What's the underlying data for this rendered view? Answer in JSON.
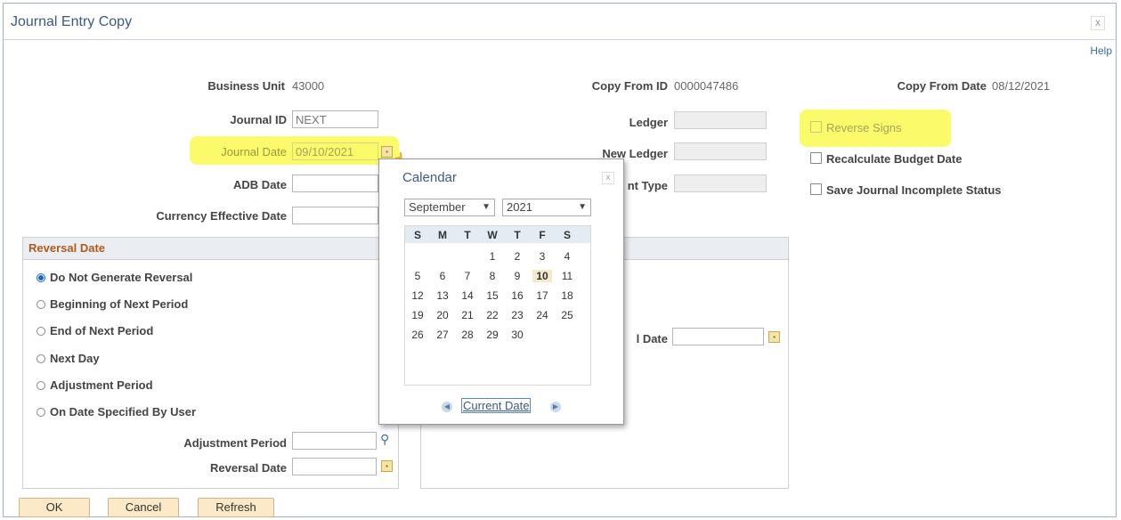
{
  "window": {
    "title": "Journal Entry Copy",
    "close": "x",
    "help": "Help"
  },
  "header": {
    "business_unit_label": "Business Unit",
    "business_unit_value": "43000",
    "copy_from_id_label": "Copy From ID",
    "copy_from_id_value": "0000047486",
    "copy_from_date_label": "Copy From Date",
    "copy_from_date_value": "08/12/2021"
  },
  "fields": {
    "journal_id_label": "Journal ID",
    "journal_id_value": "NEXT",
    "journal_date_label": "Journal Date",
    "journal_date_value": "09/10/2021",
    "adb_date_label": "ADB Date",
    "currency_effective_date_label": "Currency Effective Date",
    "ledger_label": "Ledger",
    "new_ledger_label": "New Ledger",
    "adjustment_type_label": "nt Type"
  },
  "options": {
    "reverse_signs": "Reverse Signs",
    "recalculate_budget_date": "Recalculate Budget Date",
    "save_incomplete": "Save Journal Incomplete Status"
  },
  "reversal": {
    "header": "Reversal Date",
    "radios": [
      {
        "label": "Do Not Generate Reversal",
        "selected": true
      },
      {
        "label": "Beginning of Next Period",
        "selected": false
      },
      {
        "label": "End of Next Period",
        "selected": false
      },
      {
        "label": "Next Day",
        "selected": false
      },
      {
        "label": "Adjustment Period",
        "selected": false
      },
      {
        "label": "On Date Specified By User",
        "selected": false
      }
    ],
    "adjustment_period_label": "Adjustment Period",
    "reversal_date_label": "Reversal Date"
  },
  "right_group": {
    "date_label": "l Date"
  },
  "buttons": {
    "ok": "OK",
    "cancel": "Cancel",
    "refresh": "Refresh"
  },
  "calendar": {
    "title": "Calendar",
    "close": "x",
    "month": "September",
    "year": "2021",
    "days_of_week": [
      "S",
      "M",
      "T",
      "W",
      "T",
      "F",
      "S"
    ],
    "weeks": [
      [
        "",
        "",
        "",
        "1",
        "2",
        "3",
        "4"
      ],
      [
        "5",
        "6",
        "7",
        "8",
        "9",
        "10",
        "11"
      ],
      [
        "12",
        "13",
        "14",
        "15",
        "16",
        "17",
        "18"
      ],
      [
        "19",
        "20",
        "21",
        "22",
        "23",
        "24",
        "25"
      ],
      [
        "26",
        "27",
        "28",
        "29",
        "30",
        "",
        ""
      ]
    ],
    "selected_day": "10",
    "current_date_label": "Current Date"
  },
  "colors": {
    "highlight": "#fbfa6a",
    "title": "#3a5a85",
    "group_header": "#b05a19",
    "button": "#fbe9c8"
  }
}
